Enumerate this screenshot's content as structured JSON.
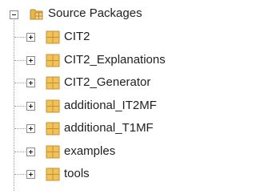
{
  "tree": {
    "root": {
      "label": "Source Packages",
      "icon": "source-packages-folder-icon",
      "expanded": true
    },
    "packages": [
      {
        "label": "CIT2",
        "icon": "package-icon",
        "expanded": false
      },
      {
        "label": "CIT2_Explanations",
        "icon": "package-icon",
        "expanded": false
      },
      {
        "label": "CIT2_Generator",
        "icon": "package-icon",
        "expanded": false
      },
      {
        "label": "additional_IT2MF",
        "icon": "package-icon",
        "expanded": false
      },
      {
        "label": "additional_T1MF",
        "icon": "package-icon",
        "expanded": false
      },
      {
        "label": "examples",
        "icon": "package-icon",
        "expanded": false
      },
      {
        "label": "tools",
        "icon": "package-icon",
        "expanded": false
      }
    ]
  },
  "colors": {
    "package_fill": "#f0c35a",
    "package_border": "#c98f2a",
    "folder_fill": "#e7b64a",
    "folder_border": "#b9872b",
    "tree_line": "#9c9c9c"
  }
}
